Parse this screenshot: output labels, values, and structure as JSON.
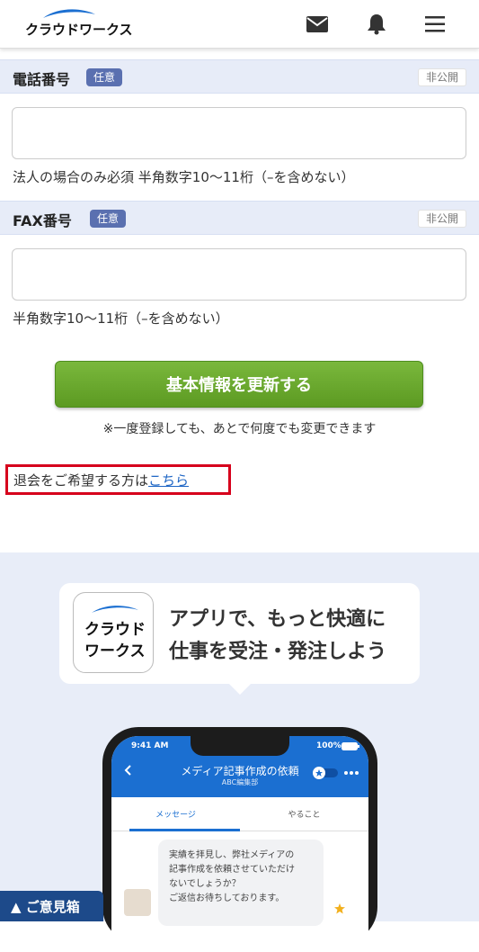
{
  "header": {
    "logo_text": "クラウドワークス",
    "icons": [
      "mail-icon",
      "bell-icon",
      "menu-icon"
    ]
  },
  "phone_section": {
    "title": "電話番号",
    "optional_badge": "任意",
    "private_badge": "非公開",
    "value": "",
    "hint": "法人の場合のみ必須 半角数字10〜11桁（–を含めない）"
  },
  "fax_section": {
    "title": "FAX番号",
    "optional_badge": "任意",
    "private_badge": "非公開",
    "value": "",
    "hint": "半角数字10〜11桁（–を含めない）"
  },
  "submit": {
    "label": "基本情報を更新する",
    "note": "※一度登録しても、あとで何度でも変更できます"
  },
  "withdraw": {
    "prefix": "退会をご希望する方は",
    "link": "こちら"
  },
  "promo": {
    "app_icon_line1": "クラウド",
    "app_icon_line2": "ワークス",
    "headline_line1": "アプリで、もっと快適に",
    "headline_line2": "仕事を受注・発注しよう",
    "phone": {
      "time": "9:41 AM",
      "battery": "100%",
      "title": "メディア記事作成の依頼",
      "subtitle": "ABC編集部",
      "tab_message": "メッセージ",
      "tab_todo": "やること",
      "message_line1": "実績を拝見し、弊社メディアの",
      "message_line2": "記事作成を依頼させていただけ",
      "message_line3": "ないでしょうか？",
      "message_line4": "ご返信お待ちしております。"
    }
  },
  "feedback_button": "▲ ご意見箱",
  "colors": {
    "accent_green": "#6aaa2e",
    "brand_blue": "#1b6fd1",
    "section_bg": "#e7ecf8",
    "highlight_red": "#d6001c"
  }
}
